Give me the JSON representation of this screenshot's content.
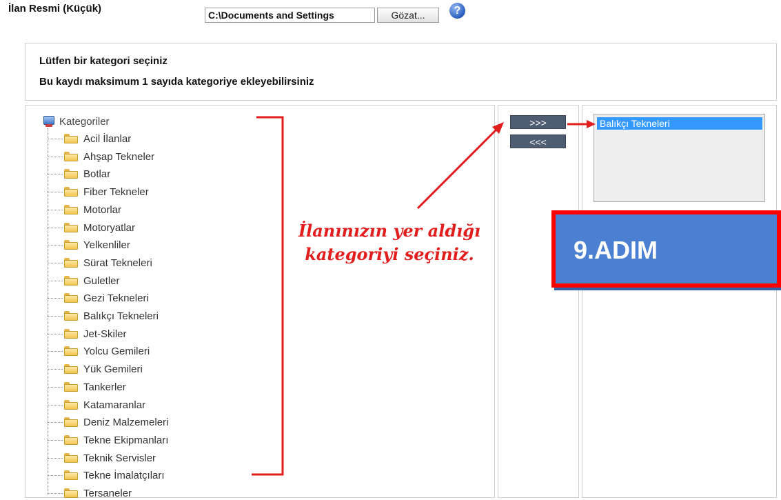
{
  "form": {
    "ilan_resmi_label": "İlan Resmi (Küçük)",
    "file_path_value": "C:\\Documents and Settings",
    "browse_label": "Gözat...",
    "help_icon": "?"
  },
  "info": {
    "line1": "Lütfen bir kategori seçiniz",
    "line2": "Bu kaydı maksimum 1 sayıda kategoriye ekleyebilirsiniz"
  },
  "tree": {
    "root_label": "Kategoriler",
    "root_icon": "computer-icon",
    "item_icon": "folder-icon",
    "items": [
      "Acil İlanlar",
      "Ahşap Tekneler",
      "Botlar",
      "Fiber Tekneler",
      "Motorlar",
      "Motoryatlar",
      "Yelkenliler",
      "Sürat Tekneleri",
      "Guletler",
      "Gezi Tekneleri",
      "Balıkçı Tekneleri",
      "Jet-Skiler",
      "Yolcu Gemileri",
      "Yük Gemileri",
      "Tankerler",
      "Katamaranlar",
      "Deniz Malzemeleri",
      "Tekne Ekipmanları",
      "Teknik Servisler",
      "Tekne İmalatçıları",
      "Tersaneler"
    ]
  },
  "buttons": {
    "add_label": ">>>",
    "remove_label": "<<<"
  },
  "selected": {
    "items": [
      "Balıkçı Tekneleri"
    ]
  },
  "annotation": {
    "line1": "İlanınızın yer aldığı",
    "line2": "kategoriyi seçiniz.",
    "step_label": "9.ADIM"
  },
  "colors": {
    "annotation_red": "#e21d1d",
    "step_box_fill": "#4a7fd2",
    "step_box_border": "#ff0000",
    "selection_blue": "#3399ff",
    "button_slate": "#4f5d73"
  }
}
